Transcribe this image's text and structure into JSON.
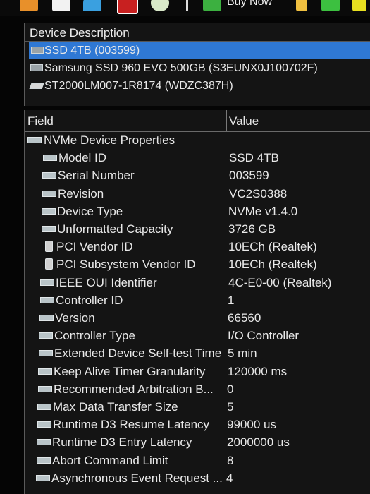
{
  "toolbar": {
    "buy_now_label": "Buy Now"
  },
  "devices": {
    "header": "Device Description",
    "items": [
      {
        "label": "SSD 4TB (003599)",
        "icon": "ssd-icon",
        "selected": true
      },
      {
        "label": "Samsung SSD 960 EVO 500GB (S3EUNX0J100702F)",
        "icon": "ssd-icon",
        "selected": false
      },
      {
        "label": "ST2000LM007-1R8174 (WDZC387H)",
        "icon": "hdd-icon",
        "selected": false
      }
    ]
  },
  "properties": {
    "col_field": "Field",
    "col_value": "Value",
    "group_label": "NVMe Device Properties",
    "rows": [
      {
        "field": "Model ID",
        "value": "SSD 4TB"
      },
      {
        "field": "Serial Number",
        "value": "003599"
      },
      {
        "field": "Revision",
        "value": "VC2S0388"
      },
      {
        "field": "Device Type",
        "value": "NVMe v1.4.0"
      },
      {
        "field": "Unformatted Capacity",
        "value": "3726 GB"
      },
      {
        "field": "PCI Vendor ID",
        "value": "10ECh (Realtek)"
      },
      {
        "field": "PCI Subsystem Vendor ID",
        "value": "10ECh (Realtek)"
      },
      {
        "field": "IEEE OUI Identifier",
        "value": "4C-E0-00 (Realtek)"
      },
      {
        "field": "Controller ID",
        "value": "1"
      },
      {
        "field": "Version",
        "value": "66560"
      },
      {
        "field": "Controller Type",
        "value": "I/O Controller"
      },
      {
        "field": "Extended Device Self-test Time",
        "value": "5 min"
      },
      {
        "field": "Keep Alive Timer Granularity",
        "value": "120000 ms"
      },
      {
        "field": "Recommended Arbitration B...",
        "value": "0"
      },
      {
        "field": "Max Data Transfer Size",
        "value": "5"
      },
      {
        "field": "Runtime D3 Resume Latency",
        "value": "99000 us"
      },
      {
        "field": "Runtime D3 Entry Latency",
        "value": "2000000 us"
      },
      {
        "field": "Abort Command Limit",
        "value": "8"
      },
      {
        "field": "Asynchronous Event Request ...",
        "value": "4"
      }
    ]
  },
  "colors": {
    "selection": "#2f78d4",
    "background": "#141414"
  }
}
